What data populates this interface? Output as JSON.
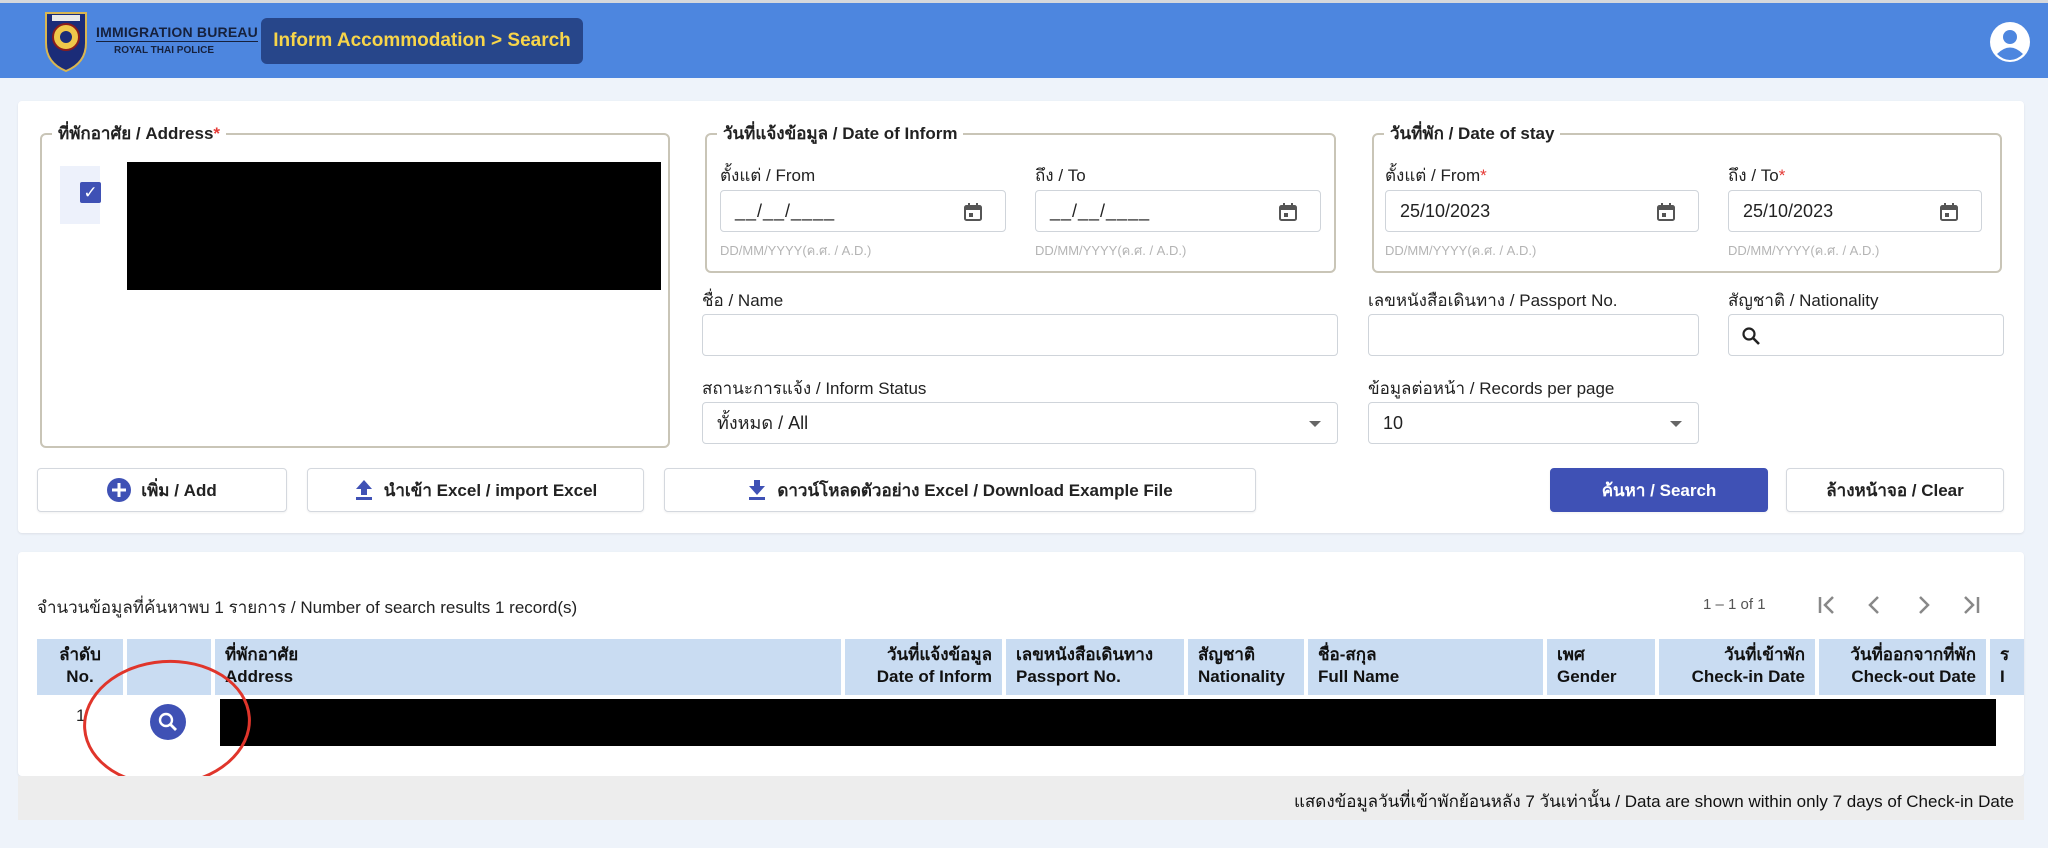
{
  "header": {
    "brand_line1": "IMMIGRATION BUREAU",
    "brand_line2": "ROYAL THAI POLICE",
    "breadcrumb": "Inform Accommodation > Search"
  },
  "form": {
    "address_legend": "ที่พักอาศัย / Address",
    "date_of_inform_legend": "วันที่แจ้งข้อมูล / Date of Inform",
    "date_of_stay_legend": "วันที่พัก / Date of stay",
    "from_label": "ตั้งแต่ / From",
    "to_label": "ถึง / To",
    "date_mask": "__/__/____",
    "date_hint": "DD/MM/YYYY(ค.ศ. / A.D.)",
    "stay_from_value": "25/10/2023",
    "stay_to_value": "25/10/2023",
    "name_label": "ชื่อ / Name",
    "passport_label": "เลขหนังสือเดินทาง / Passport No.",
    "nationality_label": "สัญชาติ / Nationality",
    "status_label": "สถานะการแจ้ง / Inform Status",
    "status_value": "ทั้งหมด / All",
    "records_label": "ข้อมูลต่อหน้า / Records per page",
    "records_value": "10"
  },
  "buttons": {
    "add": "เพิ่ม / Add",
    "import": "นำเข้า Excel / import Excel",
    "download": "ดาวน์โหลดตัวอย่าง Excel / Download Example File",
    "search": "ค้นหา / Search",
    "clear": "ล้างหน้าจอ / Clear"
  },
  "results": {
    "count_text": "จำนวนข้อมูลที่ค้นหาพบ 1 รายการ / Number of search results 1 record(s)",
    "pager_text": "1 – 1 of 1",
    "columns": [
      {
        "th": "ลำดับ",
        "en": "No."
      },
      {
        "th": "",
        "en": ""
      },
      {
        "th": "ที่พักอาศัย",
        "en": "Address"
      },
      {
        "th": "วันที่แจ้งข้อมูล",
        "en": "Date of Inform"
      },
      {
        "th": "เลขหนังสือเดินทาง",
        "en": "Passport No."
      },
      {
        "th": "สัญชาติ",
        "en": "Nationality"
      },
      {
        "th": "ชื่อ-สกุล",
        "en": "Full Name"
      },
      {
        "th": "เพศ",
        "en": "Gender"
      },
      {
        "th": "วันที่เข้าพัก",
        "en": "Check-in Date"
      },
      {
        "th": "วันที่ออกจากที่พัก",
        "en": "Check-out Date"
      },
      {
        "th": "ร",
        "en": "I"
      }
    ],
    "rows": [
      {
        "no": "1"
      }
    ],
    "footer_note": "แสดงข้อมูลวันที่เข้าพักย้อนหลัง 7 วันเท่านั้น / Data are shown within only 7 days of Check-in Date"
  },
  "colors": {
    "header_bg": "#4d86df",
    "breadcrumb_bg": "#27468a",
    "breadcrumb_text": "#f7d54a",
    "primary": "#3f51b5",
    "table_header": "#c9dcf2",
    "annotation": "#e0352b"
  }
}
